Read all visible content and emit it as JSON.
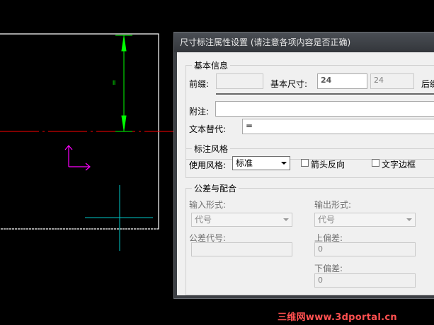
{
  "dialog": {
    "title": "尺寸标注属性设置 (请注意各项内容是否正确)",
    "basic": {
      "title": "基本信息",
      "prefix_label": "前缀:",
      "prefix_value": "",
      "basic_size_label": "基本尺寸:",
      "basic_size_value": "24",
      "basic_size_display": "24",
      "suffix_label": "后缀",
      "note_label": "附注:",
      "note_value": "",
      "text_replace_label": "文本替代:",
      "text_replace_value": "="
    },
    "style": {
      "title": "标注风格",
      "use_style_label": "使用风格:",
      "use_style_value": "标准",
      "arrow_reverse_label": "箭头反向",
      "arrow_reverse_checked": false,
      "text_border_label": "文字边框",
      "text_border_checked": false
    },
    "tolerance": {
      "title": "公差与配合",
      "input_form_label": "输入形式:",
      "input_form_value": "代号",
      "output_form_label": "输出形式:",
      "output_form_value": "代号",
      "tol_code_label": "公差代号:",
      "tol_code_value": "",
      "upper_dev_label": "上偏差:",
      "upper_dev_value": "0",
      "lower_dev_label": "下偏差:",
      "lower_dev_value": "0"
    }
  },
  "canvas": {
    "dimension_text": "=",
    "colors": {
      "background": "#000000",
      "dimension": "#00ff00",
      "centerline": "#ff0000",
      "ucs": "#ff00ff",
      "crosshair": "#00c8c8"
    }
  },
  "watermark": "三维网www.3dportal.cn"
}
